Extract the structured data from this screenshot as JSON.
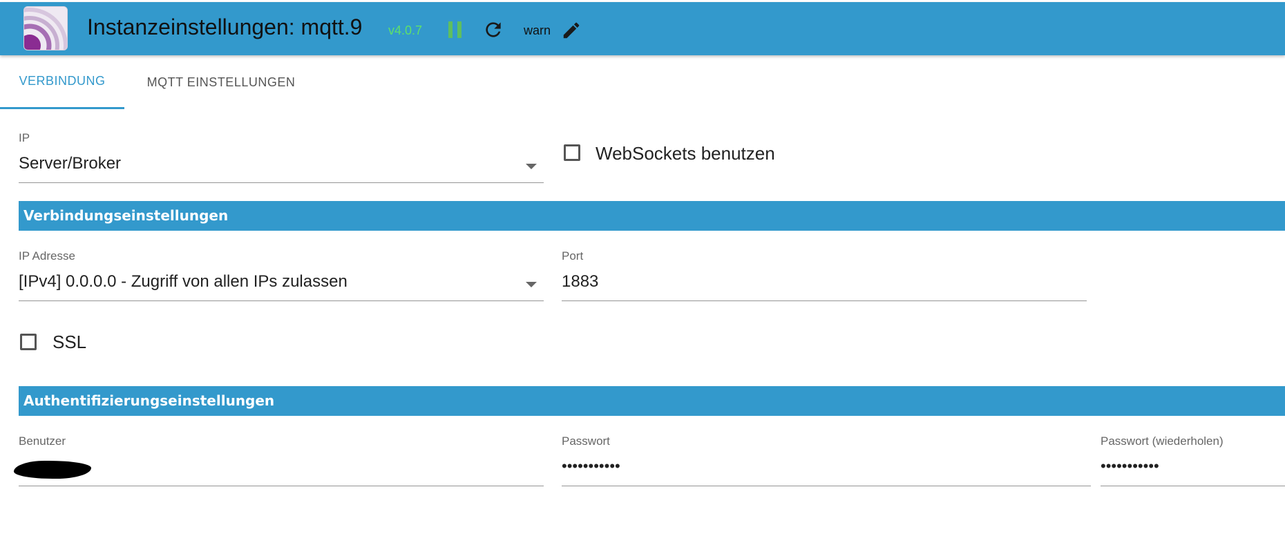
{
  "header": {
    "title": "Instanzeinstellungen: mqtt.9",
    "version": "v4.0.7",
    "log_level": "warn",
    "icons": [
      "app-logo",
      "pause-icon",
      "reload-icon",
      "edit-icon"
    ]
  },
  "tabs": [
    {
      "label": "VERBINDUNG",
      "active": true
    },
    {
      "label": "MQTT EINSTELLUNGEN",
      "active": false
    }
  ],
  "connection": {
    "type_label": "IP",
    "type_value": "Server/Broker",
    "websockets_label": "WebSockets benutzen",
    "websockets_checked": false
  },
  "connection_settings": {
    "header": "Verbindungseinstellungen",
    "ip_label": "IP Adresse",
    "ip_value": "[IPv4] 0.0.0.0 - Zugriff von allen IPs zulassen",
    "port_label": "Port",
    "port_value": "1883",
    "ssl_label": "SSL",
    "ssl_checked": false
  },
  "auth_settings": {
    "header": "Authentifizierungseinstellungen",
    "user_label": "Benutzer",
    "password_label": "Passwort",
    "password_value": "•••••••••••",
    "password_repeat_label": "Passwort (wiederholen)",
    "password_repeat_value": "•••••••••••"
  },
  "colors": {
    "primary": "#3399cc",
    "version": "#5fe06a",
    "pause": "#5fbf5f"
  }
}
